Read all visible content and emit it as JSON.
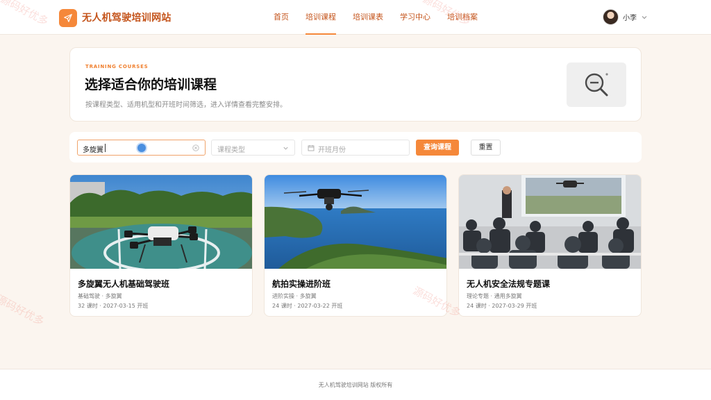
{
  "header": {
    "site_title": "无人机驾驶培训网站",
    "nav": [
      {
        "label": "首页",
        "active": false
      },
      {
        "label": "培训课程",
        "active": true
      },
      {
        "label": "培训课表",
        "active": false
      },
      {
        "label": "学习中心",
        "active": false
      },
      {
        "label": "培训档案",
        "active": false
      }
    ],
    "user_name": "小李"
  },
  "hero": {
    "eyebrow": "TRAINING COURSES",
    "title": "选择适合你的培训课程",
    "description": "按课程类型、适用机型和开班时间筛选，进入详情查看完整安排。"
  },
  "filters": {
    "search_value": "多旋翼",
    "course_type_placeholder": "课程类型",
    "month_placeholder": "开班月份",
    "query_label": "查询课程",
    "reset_label": "重置"
  },
  "courses": [
    {
      "title": "多旋翼无人机基础驾驶班",
      "tags": "基础驾驶 · 多旋翼",
      "meta": "32 课时 · 2027-03-15 开班"
    },
    {
      "title": "航拍实操进阶班",
      "tags": "进阶实操 · 多旋翼",
      "meta": "24 课时 · 2027-03-22 开班"
    },
    {
      "title": "无人机安全法规专题课",
      "tags": "理论专题 · 通用多旋翼",
      "meta": "24 课时 · 2027-03-29 开班"
    }
  ],
  "footer": {
    "text": "无人机驾驶培训网站 版权所有"
  },
  "watermark": "源码好优多",
  "colors": {
    "accent": "#f5883a",
    "brand_text": "#c4541b",
    "page_bg": "#fbf5ef"
  }
}
